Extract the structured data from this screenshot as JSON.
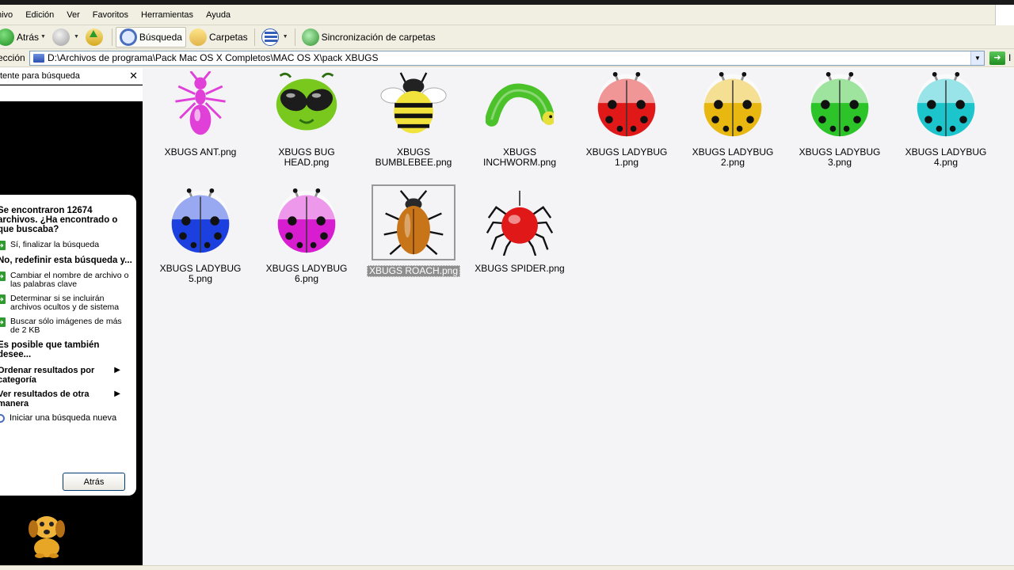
{
  "menu": [
    "hivo",
    "Edición",
    "Ver",
    "Favoritos",
    "Herramientas",
    "Ayuda"
  ],
  "toolbar": {
    "back_label": "Atrás",
    "search_label": "Búsqueda",
    "folders_label": "Carpetas",
    "sync_label": "Sincronización de carpetas"
  },
  "address": {
    "label": "ección",
    "path": "D:\\Archivos de programa\\Pack Mac OS X Completos\\MAC OS X\\pack XBUGS",
    "go_label": "I"
  },
  "search_pane": {
    "title": "tente para búsqueda",
    "close": "✕",
    "question": "Se encontraron 12674 archivos. ¿Ha encontrado o que buscaba?",
    "yes_option": "Sí, finalizar la búsqueda",
    "refine_heading": "No, redefinir esta búsqueda y...",
    "refine_options": [
      "Cambiar el nombre de archivo o las palabras clave",
      "Determinar si se incluirán archivos ocultos y de sistema",
      "Buscar sólo imágenes de más de 2 KB"
    ],
    "also_heading": "Es posible que también desee...",
    "sort_by_category": "Ordenar resultados por categoría",
    "view_other_way": "Ver resultados de otra manera",
    "new_search": "Iniciar una búsqueda nueva",
    "back_button": "Atrás"
  },
  "files": [
    {
      "name": "XBUGS ANT.png",
      "icon": "ant-icon",
      "color": "#e040d8"
    },
    {
      "name": "XBUGS BUG HEAD.png",
      "icon": "bug-head-icon",
      "color": "#78c81e"
    },
    {
      "name": "XBUGS BUMBLEBEE.png",
      "icon": "bumblebee-icon",
      "color": "#f2e23c"
    },
    {
      "name": "XBUGS INCHWORM.png",
      "icon": "inchworm-icon",
      "color": "#4cc22a"
    },
    {
      "name": "XBUGS LADYBUG 1.png",
      "icon": "ladybug-icon",
      "color": "#e01818"
    },
    {
      "name": "XBUGS LADYBUG 2.png",
      "icon": "ladybug-icon",
      "color": "#e8b810"
    },
    {
      "name": "XBUGS LADYBUG 3.png",
      "icon": "ladybug-icon",
      "color": "#2cc428"
    },
    {
      "name": "XBUGS LADYBUG 4.png",
      "icon": "ladybug-icon",
      "color": "#1cc4cc"
    },
    {
      "name": "XBUGS LADYBUG 5.png",
      "icon": "ladybug-icon",
      "color": "#1c40e0"
    },
    {
      "name": "XBUGS LADYBUG 6.png",
      "icon": "ladybug-icon",
      "color": "#d81cd0"
    },
    {
      "name": "XBUGS ROACH.png",
      "icon": "roach-icon",
      "color": "#c8751a",
      "selected": true
    },
    {
      "name": "XBUGS SPIDER.png",
      "icon": "spider-icon",
      "color": "#e01818"
    }
  ]
}
